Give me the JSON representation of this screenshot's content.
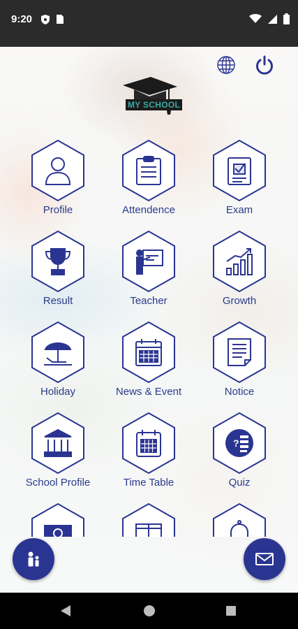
{
  "status_bar": {
    "time": "9:20",
    "icons_left": [
      "shield-icon",
      "sim-card-icon"
    ],
    "icons_right": [
      "wifi-icon",
      "signal-icon",
      "battery-icon"
    ]
  },
  "header": {
    "logo_text": "MY SCHOOL",
    "language_icon": "globe-icon",
    "logout_icon": "power-icon"
  },
  "menu": [
    {
      "label": "Profile",
      "icon": "person-icon"
    },
    {
      "label": "Attendence",
      "icon": "clipboard-icon"
    },
    {
      "label": "Exam",
      "icon": "exam-check-icon"
    },
    {
      "label": "Result",
      "icon": "trophy-icon"
    },
    {
      "label": "Teacher",
      "icon": "teacher-board-icon"
    },
    {
      "label": "Growth",
      "icon": "growth-chart-icon"
    },
    {
      "label": "Holiday",
      "icon": "beach-umbrella-icon"
    },
    {
      "label": "News & Event",
      "icon": "calendar-icon"
    },
    {
      "label": "Notice",
      "icon": "notice-document-icon"
    },
    {
      "label": "School Profile",
      "icon": "school-building-icon"
    },
    {
      "label": "Time Table",
      "icon": "timetable-calendar-icon"
    },
    {
      "label": "Quiz",
      "icon": "quiz-icon"
    },
    {
      "label": "",
      "icon": "fee-money-icon"
    },
    {
      "label": "",
      "icon": "book-icon"
    },
    {
      "label": "",
      "icon": "bell-icon"
    }
  ],
  "fabs": {
    "left_icon": "parent-child-icon",
    "right_icon": "mail-icon"
  },
  "colors": {
    "primary": "#2a3592",
    "label": "#2a3a8c",
    "status_bar": "#2b2b2b",
    "nav_bar": "#000000"
  }
}
